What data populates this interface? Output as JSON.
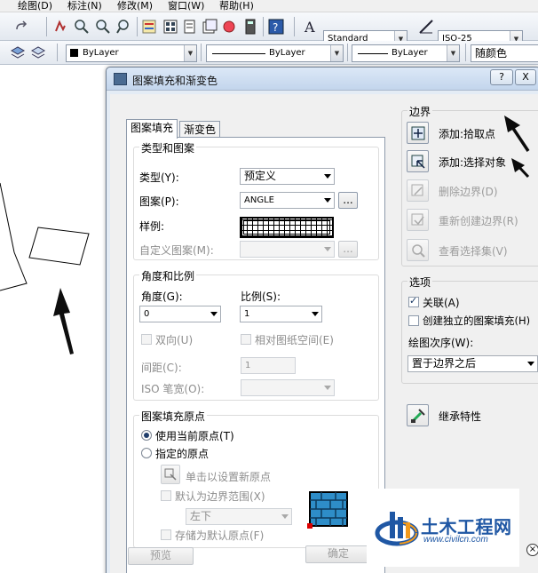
{
  "menu": [
    "绘图(D)",
    "标注(N)",
    "修改(M)",
    "窗口(W)",
    "帮助(H)"
  ],
  "toolbar": {
    "text_style": "Standard",
    "dim_style": "ISO-25",
    "layer_color": "ByLayer",
    "linetype": "ByLayer",
    "lineweight": "ByLayer",
    "plot_style": "随颜色"
  },
  "dialog": {
    "title": "图案填充和渐变色",
    "help_button": "?",
    "close_button": "X",
    "tabs": [
      "图案填充",
      "渐变色"
    ],
    "type_pattern": {
      "group_title": "类型和图案",
      "type_label": "类型(Y):",
      "type_value": "预定义",
      "pattern_label": "图案(P):",
      "pattern_value": "ANGLE",
      "browse_button": "...",
      "sample_label": "样例:",
      "custom_label": "自定义图案(M):",
      "custom_browse": "..."
    },
    "angle_scale": {
      "group_title": "角度和比例",
      "angle_label": "角度(G):",
      "angle_value": "0",
      "scale_label": "比例(S):",
      "scale_value": "1",
      "double_label": "双向(U)",
      "relative_label": "相对图纸空间(E)",
      "spacing_label": "间距(C):",
      "spacing_value": "1",
      "iso_label": "ISO 笔宽(O):"
    },
    "origin": {
      "group_title": "图案填充原点",
      "use_current": "使用当前原点(T)",
      "specified": "指定的原点",
      "click_set": "单击以设置新原点",
      "default_extent": "默认为边界范围(X)",
      "extent_value": "左下",
      "store_default": "存储为默认原点(F)"
    },
    "boundaries": {
      "group_title": "边界",
      "add_pick": "添加:拾取点",
      "add_select": "添加:选择对象",
      "remove": "删除边界(D)",
      "recreate": "重新创建边界(R)",
      "view_selection": "查看选择集(V)"
    },
    "options": {
      "group_title": "选项",
      "associative": "关联(A)",
      "separate": "创建独立的图案填充(H)",
      "draw_order_label": "绘图次序(W):",
      "draw_order_value": "置于边界之后"
    },
    "inherit": "继承特性",
    "preview_button": "预览",
    "ok_button": "确定"
  },
  "watermark": {
    "title": "土木工程网",
    "url": "www.civilcn.com"
  }
}
